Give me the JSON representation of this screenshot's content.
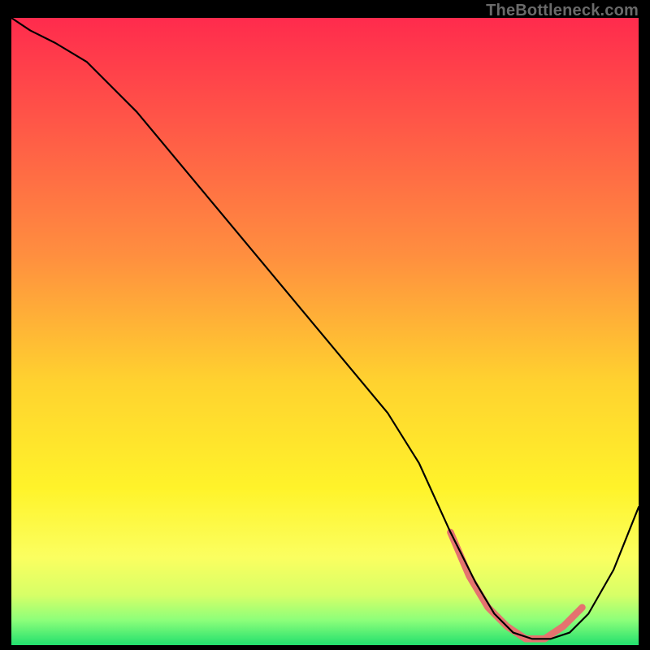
{
  "watermark": "TheBottleneck.com",
  "chart_data": {
    "type": "line",
    "title": "",
    "xlabel": "",
    "ylabel": "",
    "xlim": [
      0,
      100
    ],
    "ylim": [
      0,
      100
    ],
    "grid": false,
    "legend": false,
    "background": {
      "style": "vertical-gradient",
      "stops": [
        {
          "pos": 0.0,
          "color": "#ff2b4d"
        },
        {
          "pos": 0.18,
          "color": "#ff5a47"
        },
        {
          "pos": 0.38,
          "color": "#ff8f3f"
        },
        {
          "pos": 0.58,
          "color": "#ffd22f"
        },
        {
          "pos": 0.75,
          "color": "#fff32a"
        },
        {
          "pos": 0.86,
          "color": "#fbff60"
        },
        {
          "pos": 0.92,
          "color": "#d7ff67"
        },
        {
          "pos": 0.96,
          "color": "#8dff7a"
        },
        {
          "pos": 1.0,
          "color": "#22e06e"
        }
      ]
    },
    "series": [
      {
        "name": "bottleneck-curve",
        "color": "#000000",
        "width": 2,
        "x": [
          0,
          3,
          7,
          12,
          20,
          30,
          40,
          50,
          60,
          65,
          70,
          74,
          77,
          80,
          83,
          86,
          89,
          92,
          96,
          100
        ],
        "y": [
          100,
          98,
          96,
          93,
          85,
          73,
          61,
          49,
          37,
          29,
          18,
          10,
          5,
          2,
          1,
          1,
          2,
          5,
          12,
          22
        ]
      }
    ],
    "annotations": [
      {
        "name": "optimal-band",
        "type": "highlight-segment",
        "color": "#e5736f",
        "width": 8,
        "x": [
          70,
          73,
          76,
          79,
          82,
          85,
          88,
          91
        ],
        "y": [
          18,
          11,
          6,
          3,
          1,
          1,
          3,
          6
        ]
      }
    ]
  }
}
